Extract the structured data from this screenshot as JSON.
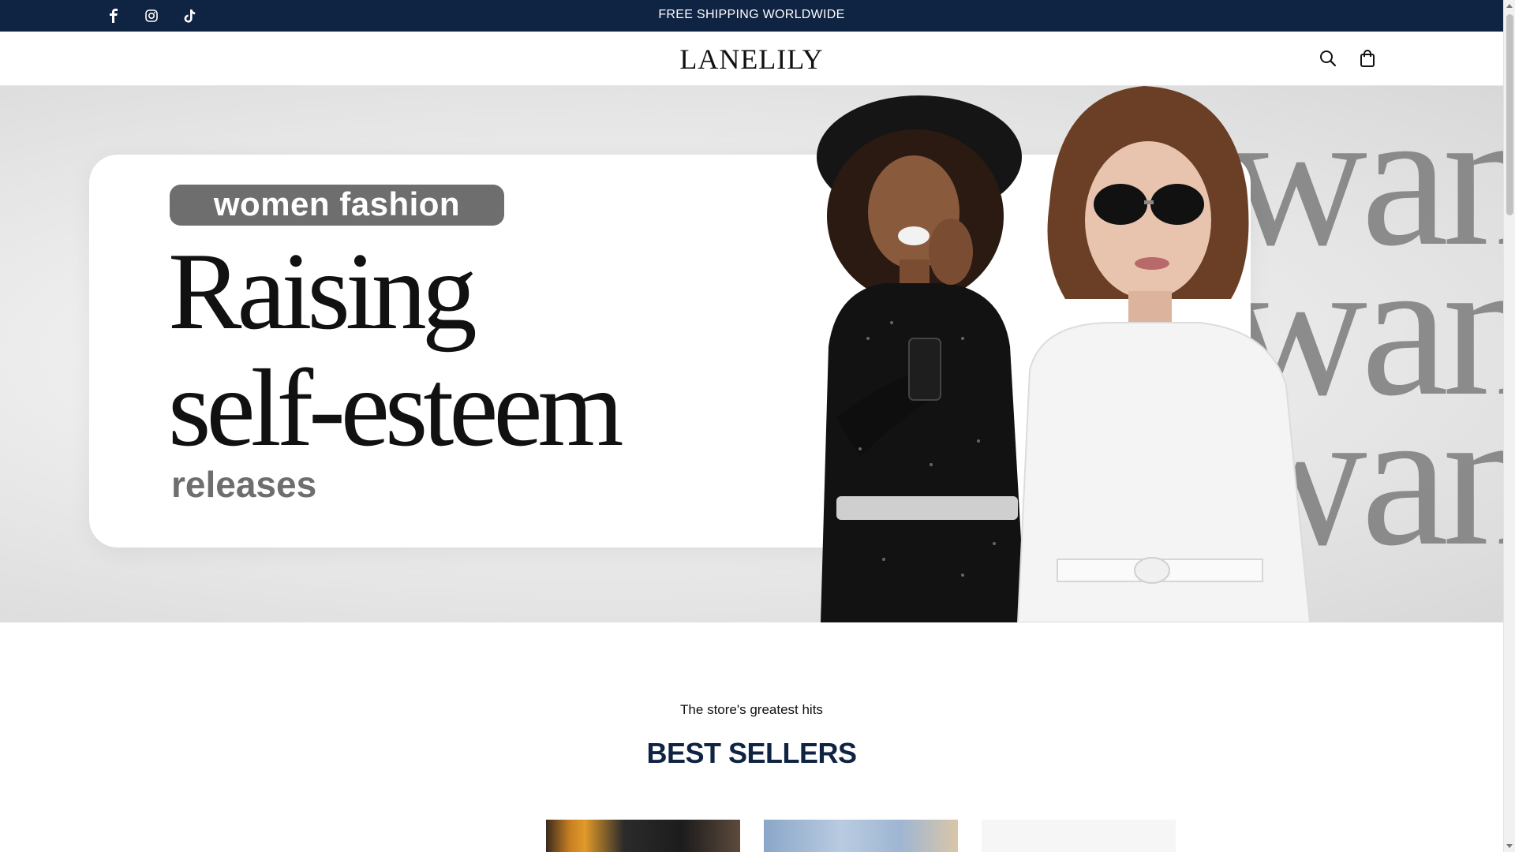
{
  "announcement": {
    "text": "FREE SHIPPING WORLDWIDE",
    "social_icons": [
      "facebook-icon",
      "instagram-icon",
      "tiktok-icon"
    ]
  },
  "header": {
    "logo": "LANELILY",
    "icons": [
      "search-icon",
      "bag-icon"
    ]
  },
  "hero": {
    "tag": "women fashion",
    "headline": "Raising\nself-esteem",
    "subline": "releases",
    "background_text": "wan\nwan\nwan"
  },
  "best_sellers": {
    "subtitle": "The store's greatest hits",
    "title": "BEST SELLERS"
  },
  "colors": {
    "navy": "#0f2342",
    "pill_gray": "#6e6e6e"
  }
}
